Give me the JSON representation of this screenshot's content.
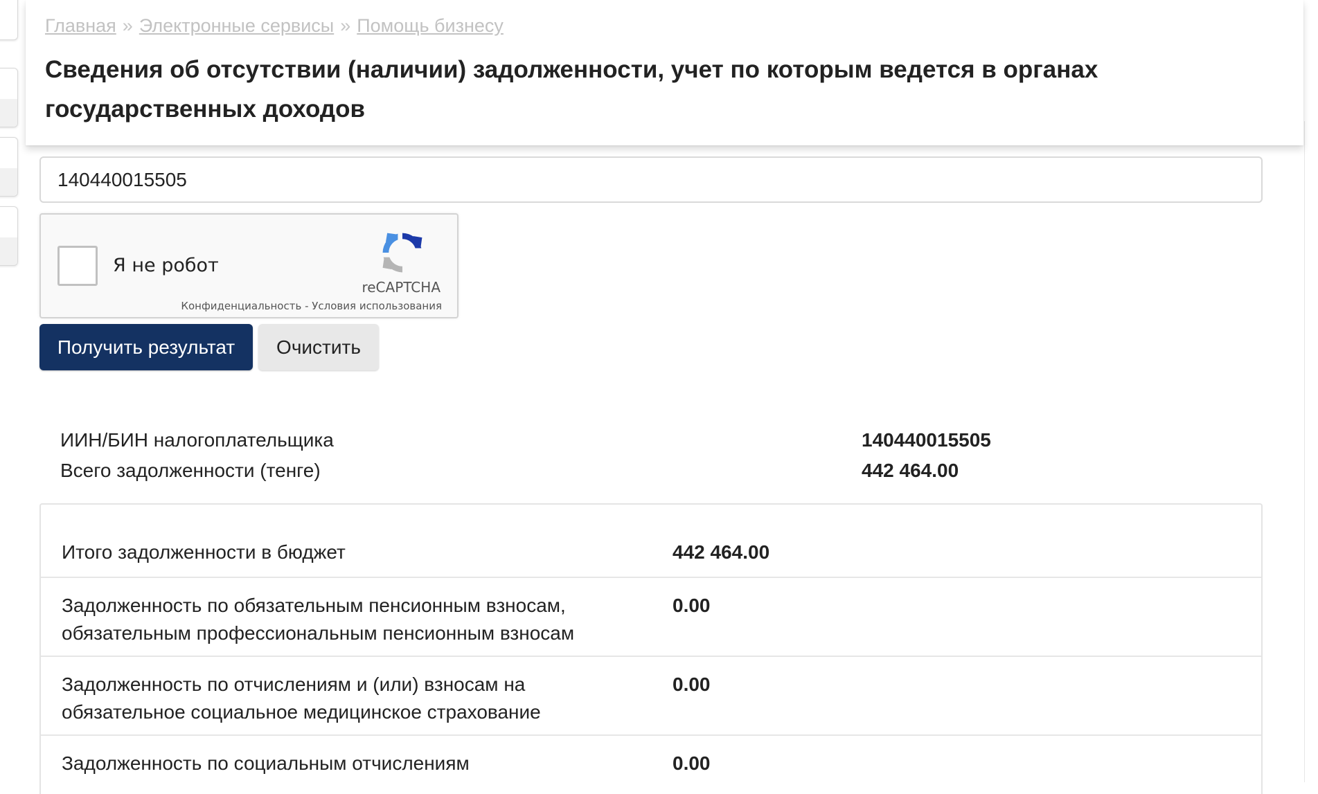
{
  "breadcrumb": {
    "items": [
      "Главная",
      "Электронные сервисы",
      "Помощь бизнесу"
    ],
    "separator": "»"
  },
  "page": {
    "title": "Сведения об отсутствии (наличии) задолженности, учет по которым ведется в органах государственных доходов"
  },
  "form": {
    "iin_value": "140440015505",
    "recaptcha": {
      "label": "Я не робот",
      "brand": "reCAPTCHA",
      "privacy_link": "Конфиденциальность",
      "link_separator": " - ",
      "terms_link": "Условия использования",
      "checked": false
    },
    "submit_label": "Получить результат",
    "clear_label": "Очистить"
  },
  "summary": {
    "rows": [
      {
        "label": "ИИН/БИН налогоплательщика",
        "value": "140440015505"
      },
      {
        "label": "Всего задолженности (тенге)",
        "value": "442 464.00"
      }
    ]
  },
  "details": {
    "rows": [
      {
        "label": "Итого задолженности в бюджет",
        "value": "442 464.00"
      },
      {
        "label": "Задолженность по обязательным пенсионным взносам, обязательным профессиональным пенсионным взносам",
        "value": "0.00"
      },
      {
        "label": "Задолженность по отчислениям и (или) взносам на обязательное социальное медицинское страхование",
        "value": "0.00"
      },
      {
        "label": "Задолженность по социальным отчислениям",
        "value": "0.00"
      }
    ]
  },
  "colors": {
    "primary_button": "#143262",
    "secondary_button": "#e8e8e8",
    "breadcrumb_link": "#c2c2c2"
  }
}
